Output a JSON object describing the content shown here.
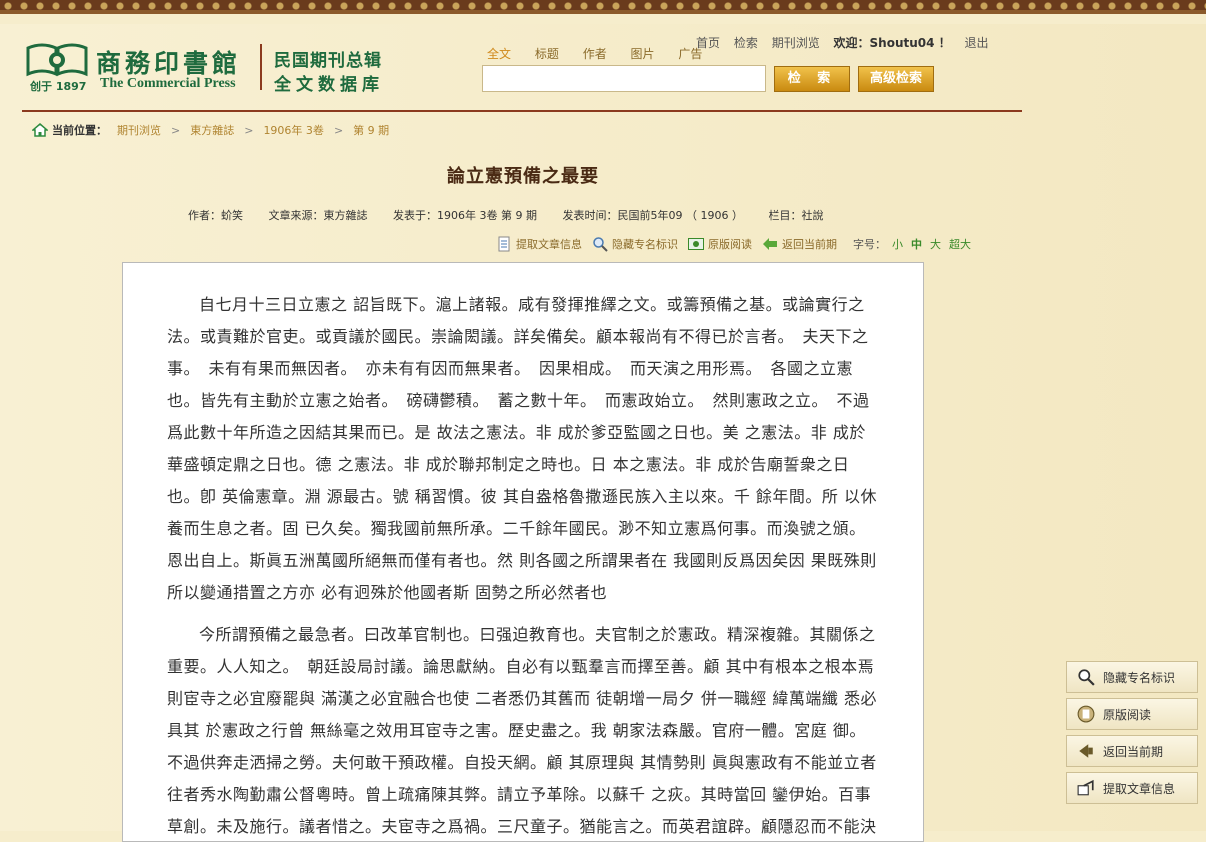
{
  "logo": {
    "name_cn": "商務印書館",
    "established": "创于 1897",
    "name_en": "The Commercial Press",
    "db_line1": "民国期刊总辑",
    "db_line2": "全文数据库"
  },
  "search": {
    "tabs": [
      "全文",
      "标题",
      "作者",
      "图片",
      "广告"
    ],
    "active_tab": "全文",
    "input_value": "",
    "search_button": "检 索",
    "advanced_button": "高级检索"
  },
  "topnav": {
    "home": "首页",
    "search": "检索",
    "browse": "期刊浏览",
    "welcome": "欢迎：Shoutu04 ！",
    "logout": "退出"
  },
  "breadcrumb": {
    "label": "当前位置：",
    "items": [
      "期刊浏览",
      "東方雜誌",
      "1906年 3卷",
      "第 9 期"
    ]
  },
  "article": {
    "title": "論立憲預備之最要",
    "meta": {
      "author": "作者：蚧笑",
      "source": "文章来源：東方雜誌",
      "published_in": "发表于：1906年 3卷 第 9 期",
      "pub_time": "发表时间：民国前5年09 （ 1906 ）",
      "column": "栏目：社說"
    },
    "paragraphs": [
      "自七月十三日立憲之 詔旨既下。滬上諸報。咸有發揮推繹之文。或籌預備之基。或論實行之法。或責難於官吏。或貢議於國民。崇論閎議。詳矣備矣。顧本報尚有不得已於言者。　夫天下之事。　未有有果而無因者。　亦未有有因而無果者。　因果相成。　而天演之用形焉。　各國之立憲也。皆先有主動於立憲之始者。　磅礴鬱積。　蓄之數十年。　而憲政始立。　然則憲政之立。　不過爲此數十年所造之因結其果而已。是 故法之憲法。非 成於爹亞監國之日也。美 之憲法。非 成於華盛頓定鼎之日也。德 之憲法。非 成於聯邦制定之時也。日 本之憲法。非 成於告廟誓衆之日也。卽 英倫憲章。淵 源最古。號 稱習慣。彼 其自盎格魯撒遜民族入主以來。千 餘年間。所 以休養而生息之者。固 已久矣。獨我國前無所承。二千餘年國民。渺不知立憲爲何事。而渙號之頒。　恩出自上。斯眞五洲萬國所絕無而僅有者也。然 則各國之所謂果者在 我國則反爲因矣因 果既殊則 所以變通措置之方亦 必有迥殊於他國者斯 固勢之所必然者也",
      "今所謂預備之最急者。曰改革官制也。曰强迫教育也。夫官制之於憲政。精深複雜。其關係之重要。人人知之。　朝廷設局討議。論思獻納。自必有以甄羣言而擇至善。顧 其中有根本之根本焉則宦寺之必宜廢罷與 滿漢之必宜融合也使 二者悉仍其舊而 徒朝增一局夕 併一職經 緯萬端纖 悉必具其 於憲政之行曾 無絲毫之效用耳宦寺之害。歷史盡之。我 朝家法森嚴。官府一體。宮庭 御。不過供奔走洒掃之勞。夫何敢干預政權。自投天網。顧 其原理與 其情勢則 眞與憲政有不能並立者往者秀水陶勤肅公督粵時。曾上疏痛陳其弊。請立予革除。以蘇千 之疢。其時當回 鑾伊始。百事草創。未及施行。議者惜之。夫宦寺之爲禍。三尺童子。猶能言之。而英君誼辟。顧隱忍而不能決去"
    ]
  },
  "tools": {
    "extract_info": "提取文章信息",
    "hide_names": "隐藏专名标识",
    "original": "原版阅读",
    "back_issue": "返回当前期",
    "font_label": "字号：",
    "sizes": [
      "小",
      "中",
      "大",
      "超大"
    ],
    "active_size": "中"
  },
  "side": {
    "hide_names": "隐藏专名标识",
    "original": "原版阅读",
    "back_issue": "返回当前期",
    "extract_info": "提取文章信息"
  },
  "colors": {
    "brand_green": "#1f6b3e",
    "header_rule": "#8b3a1e",
    "gold_button": "#d89a1c",
    "link_gold": "#b08430",
    "background": "#f6edcc"
  }
}
